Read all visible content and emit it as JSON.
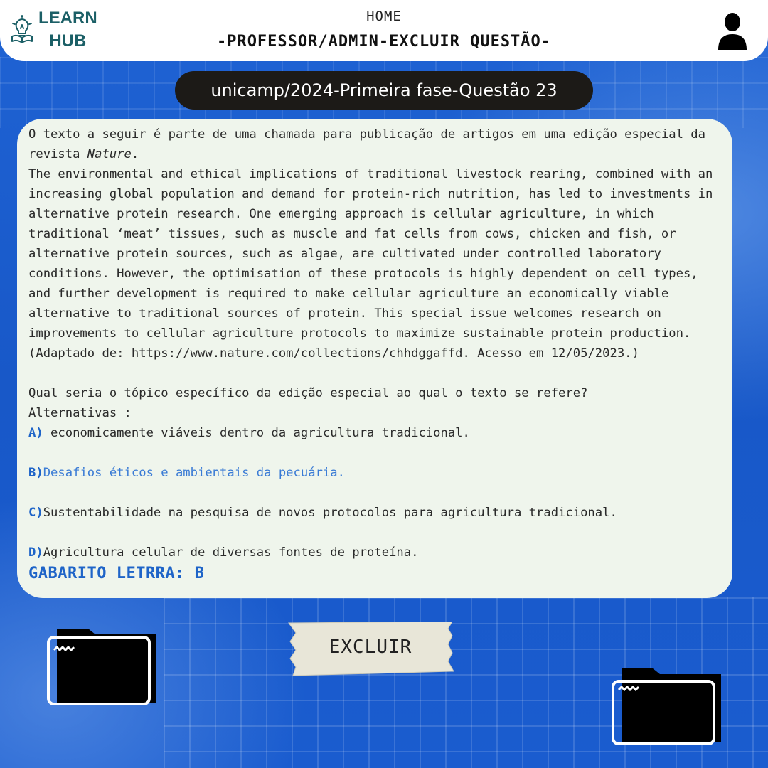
{
  "header": {
    "logo_line1": "LEARN",
    "logo_line2": "HUB",
    "home_link": "HOME",
    "page_title": "-PROFESSOR/ADMIN-EXCLUIR QUESTÃO-"
  },
  "question_tag": "unicamp/2024-Primeira fase-Questão 23",
  "question": {
    "intro": "O texto a seguir é parte de uma chamada para publicação de artigos em uma edição especial da revista ",
    "intro_italic": "Nature",
    "intro_end": ".",
    "passage": "The environmental and ethical implications of traditional livestock rearing, combined with an increasing global population and demand for protein-rich nutrition, has led to investments in alternative protein research. One emerging approach is cellular agriculture, in which traditional ‘meat’ tissues, such as muscle and fat cells from cows, chicken and fish, or alternative protein sources, such as algae, are cultivated under controlled laboratory conditions. However, the optimisation of these protocols is highly dependent on cell types, and further development is required to make cellular agriculture an economically viable alternative to traditional sources of protein. This special issue welcomes research on improvements to cellular agriculture protocols to maximize sustainable protein production.",
    "source": "(Adaptado de: https://www.nature.com/collections/chhdggaffd. Acesso em 12/05/2023.)",
    "prompt": "Qual seria o tópico específico da edição especial ao qual o texto se refere?",
    "alternatives_label": "Alternativas :",
    "options": [
      {
        "letter": "A)",
        "text": " economicamente viáveis dentro da agricultura tradicional."
      },
      {
        "letter": "B)",
        "text": "Desafios éticos e ambientais da pecuária."
      },
      {
        "letter": "C)",
        "text": "Sustentabilidade na pesquisa de novos protocolos para agricultura tradicional."
      },
      {
        "letter": "D)",
        "text": "Agricultura celular de diversas fontes de proteína."
      }
    ],
    "answer": "GABARITO LETRRA: B"
  },
  "delete_button": "EXCLUIR",
  "colors": {
    "background": "#1d5fd0",
    "card": "#eff5ec",
    "accent": "#1e64c8",
    "pill": "#1c1a17",
    "logo": "#1b5f66"
  },
  "icons": [
    "lightbulb-book-icon",
    "user-icon",
    "folder-icon"
  ]
}
